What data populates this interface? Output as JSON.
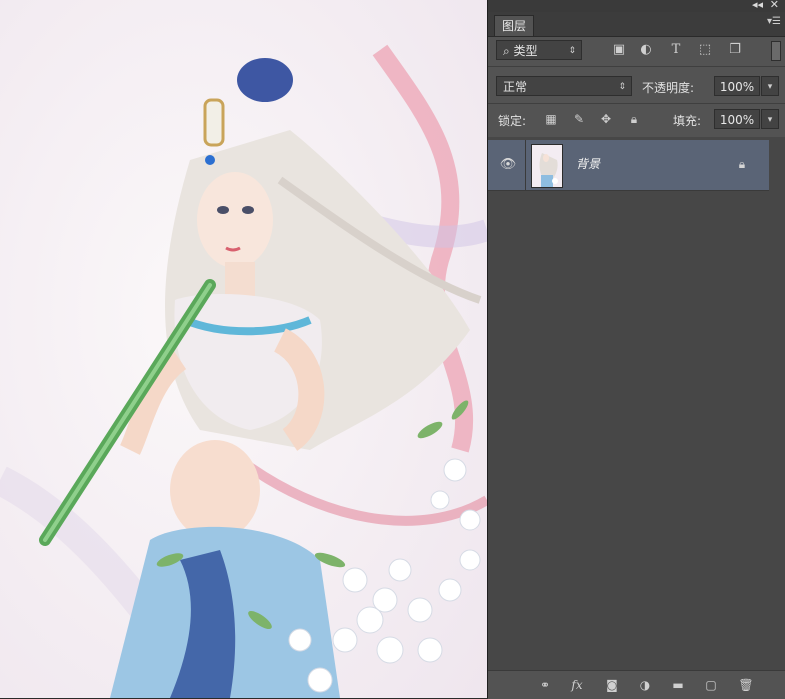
{
  "panel": {
    "collapse_icon": "double-chevron-left-icon",
    "close_icon": "close-icon",
    "tab_label": "图层",
    "menu_icon": "panel-menu-icon"
  },
  "filter": {
    "kind_label": "类型",
    "icons": [
      "image-filter-icon",
      "adjustment-filter-icon",
      "type-filter-icon",
      "shape-filter-icon",
      "smart-object-filter-icon"
    ]
  },
  "blend": {
    "mode": "正常",
    "opacity_label": "不透明度:",
    "opacity_value": "100%"
  },
  "lock": {
    "label": "锁定:",
    "icons": [
      "lock-transparent-icon",
      "lock-image-icon",
      "lock-position-icon",
      "lock-all-icon"
    ],
    "fill_label": "填充:",
    "fill_value": "100%"
  },
  "layers": [
    {
      "name": "背景",
      "visible": true,
      "locked": true
    }
  ],
  "footer_icons": [
    "link-layers-icon",
    "fx-icon",
    "add-mask-icon",
    "adjustment-layer-icon",
    "new-group-icon",
    "new-layer-icon",
    "delete-layer-icon"
  ]
}
